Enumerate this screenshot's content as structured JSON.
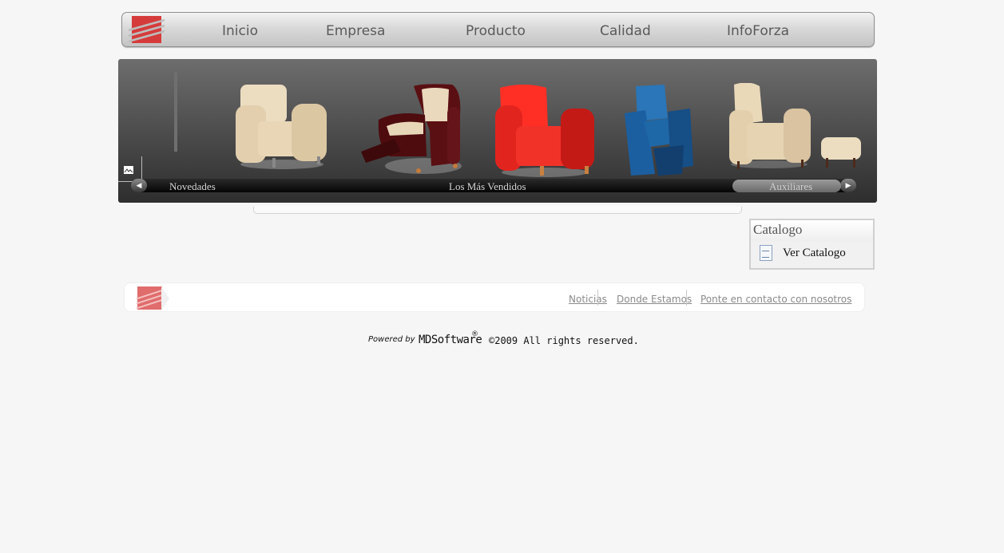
{
  "nav": {
    "items": [
      {
        "label": "Inicio"
      },
      {
        "label": "Empresa"
      },
      {
        "label": "Producto"
      },
      {
        "label": "Calidad"
      },
      {
        "label": "InfoForza"
      }
    ]
  },
  "carousel": {
    "tabs": [
      {
        "label": "Novedades"
      },
      {
        "label": "Los Más Vendidos"
      },
      {
        "label": "Auxiliares"
      }
    ],
    "chairs": [
      {
        "name": "beige armchair",
        "color": "#e8d6b7"
      },
      {
        "name": "burgundy recliner",
        "color": "#5a0f12"
      },
      {
        "name": "red armchair",
        "color": "#e2241f"
      },
      {
        "name": "blue chair",
        "color": "#1b5fa0"
      },
      {
        "name": "beige wingback with footstool",
        "color": "#e5d3b1"
      }
    ]
  },
  "catalog": {
    "title": "Catalogo",
    "link": "Ver Catalogo"
  },
  "footer": {
    "links": [
      {
        "label": "Noticias"
      },
      {
        "label": "Donde Estamos"
      },
      {
        "label": "Ponte en contacto con nosotros"
      }
    ]
  },
  "credits": {
    "powered_by": "Powered by",
    "vendor": "MDSoftware",
    "reg": "®",
    "copyright": "©2009 All rights reserved."
  },
  "colors": {
    "brand_red": "#d63b3b",
    "background": "#f6f6f6"
  }
}
